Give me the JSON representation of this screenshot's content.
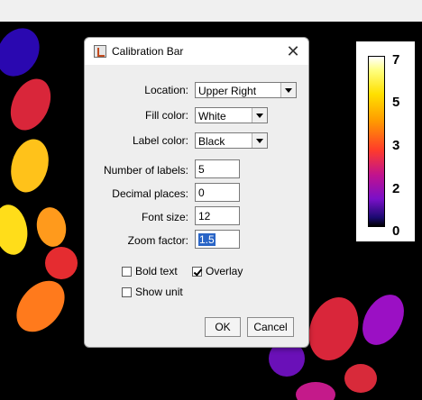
{
  "dialog": {
    "title": "Calibration Bar",
    "close_symbol": "✕",
    "location": {
      "label": "Location:",
      "value": "Upper Right"
    },
    "fill_color": {
      "label": "Fill color:",
      "value": "White"
    },
    "label_color": {
      "label": "Label color:",
      "value": "Black"
    },
    "number_of_labels": {
      "label": "Number of labels:",
      "value": "5"
    },
    "decimal_places": {
      "label": "Decimal places:",
      "value": "0"
    },
    "font_size": {
      "label": "Font size:",
      "value": "12"
    },
    "zoom_factor": {
      "label": "Zoom factor:",
      "value": "1.5"
    },
    "bold_text": {
      "label": "Bold text",
      "checked": false
    },
    "overlay": {
      "label": "Overlay",
      "checked": true
    },
    "show_unit": {
      "label": "Show unit",
      "checked": false
    },
    "ok_label": "OK",
    "cancel_label": "Cancel"
  },
  "calibration_bar": {
    "labels": [
      "7",
      "5",
      "3",
      "2",
      "0"
    ]
  },
  "colors": {
    "background": "#000000",
    "dialog_bg": "#eeeeee",
    "selection": "#2a65c6"
  },
  "icons": [
    "java-app-icon",
    "close-icon",
    "dropdown-arrow-icon",
    "checkbox-icon"
  ]
}
